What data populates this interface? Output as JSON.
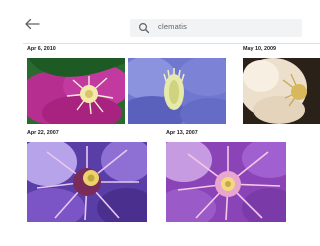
{
  "toolbar": {
    "back_icon": "arrow-back-icon",
    "search": {
      "icon": "search-icon",
      "query": "clematis"
    }
  },
  "groups": [
    {
      "date": "Apr 6, 2010",
      "photos": [
        "purple clematis flower",
        "blue clematis flower"
      ]
    },
    {
      "date": "May 10, 2009",
      "photos": [
        "white clematis flower"
      ]
    },
    {
      "date": "Apr 22, 2007",
      "photos": [
        "purple clematis close-up"
      ]
    },
    {
      "date": "Apr 13, 2007",
      "photos": [
        "pink clematis close-up"
      ]
    }
  ],
  "colors": {
    "background": "#ffffff",
    "search_bg": "#f1f3f4",
    "text": "#202124",
    "muted": "#5f6368"
  }
}
